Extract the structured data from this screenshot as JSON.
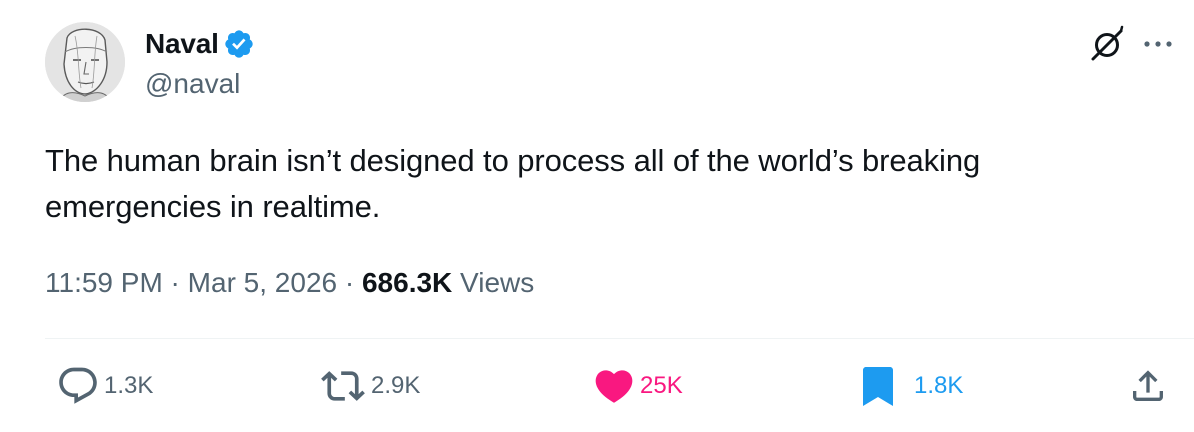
{
  "author": {
    "display_name": "Naval",
    "handle": "@naval",
    "verified": true,
    "avatar_icon": "avatar-sketch-head"
  },
  "header_icons": {
    "grok": "grok-icon",
    "more": "more-options-icon"
  },
  "tweet": {
    "text": "The human brain isn’t designed to process all of the world’s breaking\nemergencies in realtime."
  },
  "meta": {
    "time": "11:59 PM",
    "separator": " · ",
    "date": "Mar 5, 2026",
    "views_count": "686.3K",
    "views_label": " Views"
  },
  "actions": {
    "replies": "1.3K",
    "retweets": "2.9K",
    "likes": "25K",
    "bookmarks": "1.8K"
  },
  "colors": {
    "text_primary": "#0f1419",
    "text_secondary": "#536471",
    "like": "#f91880",
    "bookmark": "#1d9bf0",
    "verified": "#1d9bf0",
    "divider": "#eff3f4"
  }
}
